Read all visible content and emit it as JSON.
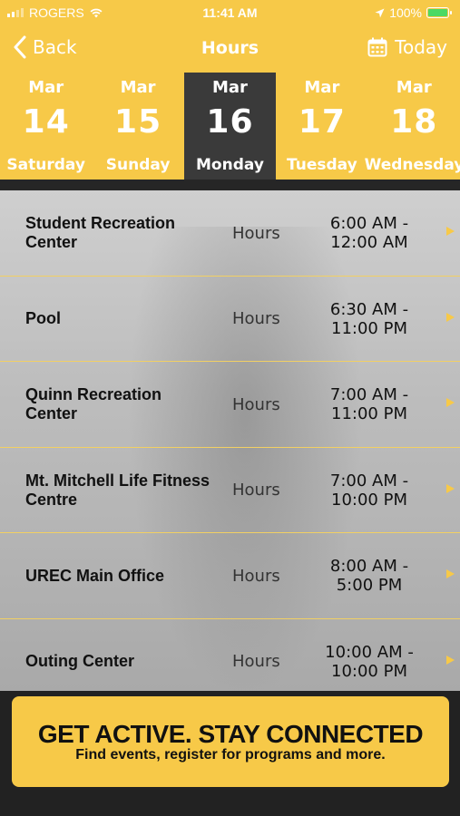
{
  "status_bar": {
    "carrier": "ROGERS",
    "time": "11:41 AM",
    "battery": "100%"
  },
  "nav": {
    "back_label": "Back",
    "title": "Hours",
    "today_label": "Today"
  },
  "dates": [
    {
      "month": "Mar",
      "day": "14",
      "weekday": "Saturday"
    },
    {
      "month": "Mar",
      "day": "15",
      "weekday": "Sunday"
    },
    {
      "month": "Mar",
      "day": "16",
      "weekday": "Monday"
    },
    {
      "month": "Mar",
      "day": "17",
      "weekday": "Tuesday"
    },
    {
      "month": "Mar",
      "day": "18",
      "weekday": "Wednesday"
    }
  ],
  "selected_date_index": 2,
  "facilities": [
    {
      "name": "Student Recreation Center",
      "label": "Hours",
      "open": "6:00 AM -",
      "close": "12:00 AM"
    },
    {
      "name": "Pool",
      "label": "Hours",
      "open": "6:30 AM -",
      "close": "11:00 PM"
    },
    {
      "name": "Quinn Recreation Center",
      "label": "Hours",
      "open": "7:00 AM -",
      "close": "11:00 PM"
    },
    {
      "name": "Mt. Mitchell Life Fitness Centre",
      "label": "Hours",
      "open": "7:00 AM -",
      "close": "10:00 PM"
    },
    {
      "name": "UREC Main Office",
      "label": "Hours",
      "open": "8:00 AM -",
      "close": "5:00 PM"
    },
    {
      "name": "Outing Center",
      "label": "Hours",
      "open": "10:00 AM -",
      "close": "10:00 PM"
    }
  ],
  "banner": {
    "headline": "GET ACTIVE.  STAY CONNECTED",
    "subline": "Find events, register for programs and more."
  },
  "colors": {
    "accent": "#f7c948",
    "selected_date_bg": "#3a3a3a"
  }
}
